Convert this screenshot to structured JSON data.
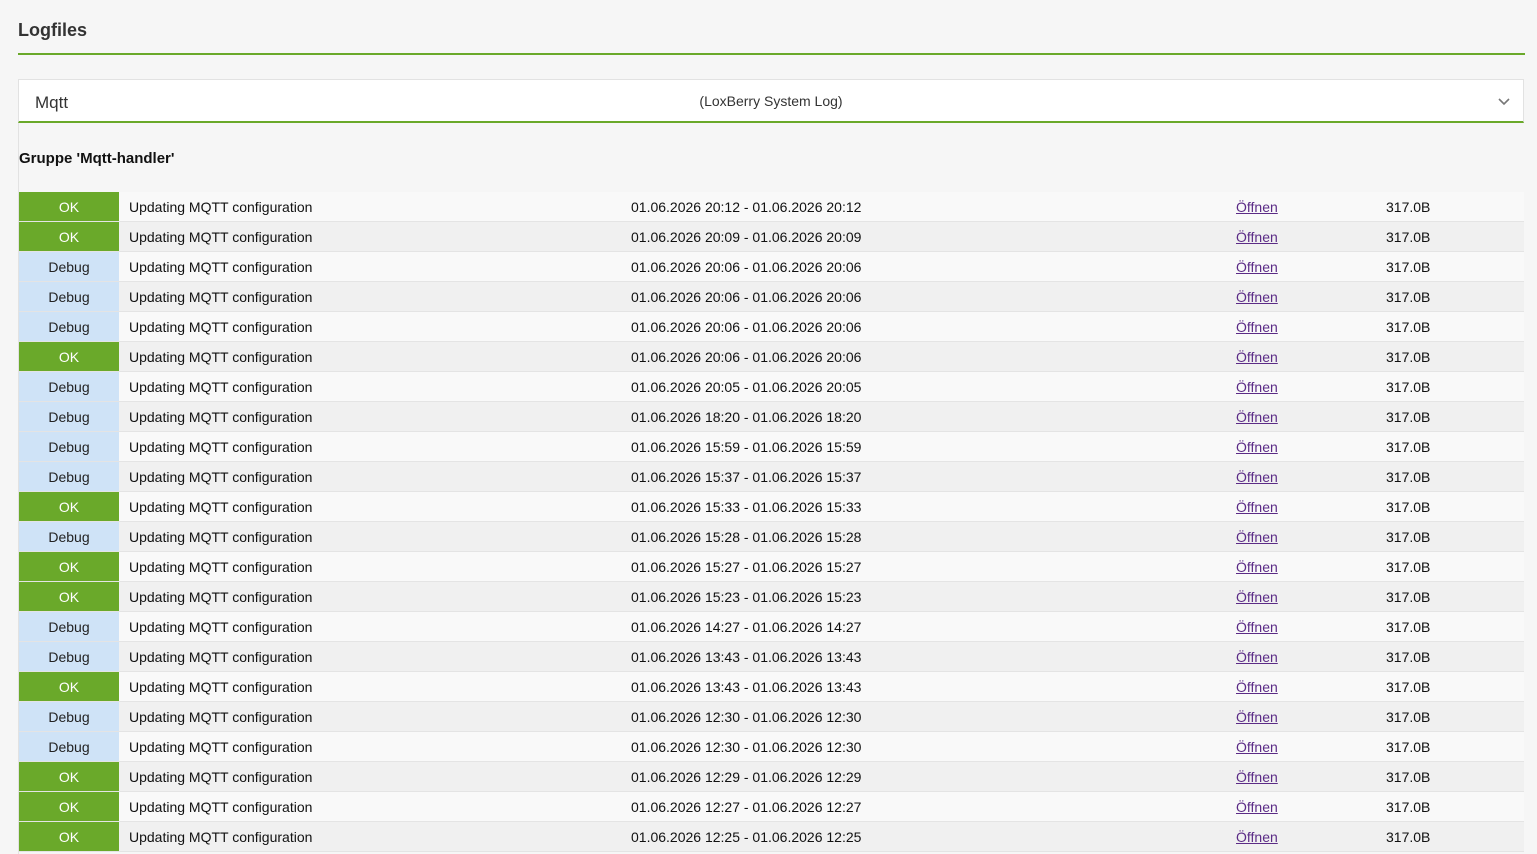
{
  "page": {
    "title": "Logfiles"
  },
  "plugin": {
    "name": "Mqtt",
    "subtitle": "(LoxBerry System Log)"
  },
  "group": {
    "title": "Gruppe 'Mqtt-handler'"
  },
  "colors": {
    "accent": "#6aa92a",
    "ok": "#6aa92a",
    "debug": "#cfe3f7",
    "link": "#5b2b86"
  },
  "icons": {
    "expand": "chevron-down-icon"
  },
  "logs": [
    {
      "level": "OK",
      "desc": "Updating MQTT configuration",
      "time": "01.06.2026 20:12 - 01.06.2026 20:12",
      "open": "Öffnen",
      "size": "317.0B"
    },
    {
      "level": "OK",
      "desc": "Updating MQTT configuration",
      "time": "01.06.2026 20:09 - 01.06.2026 20:09",
      "open": "Öffnen",
      "size": "317.0B"
    },
    {
      "level": "Debug",
      "desc": "Updating MQTT configuration",
      "time": "01.06.2026 20:06 - 01.06.2026 20:06",
      "open": "Öffnen",
      "size": "317.0B"
    },
    {
      "level": "Debug",
      "desc": "Updating MQTT configuration",
      "time": "01.06.2026 20:06 - 01.06.2026 20:06",
      "open": "Öffnen",
      "size": "317.0B"
    },
    {
      "level": "Debug",
      "desc": "Updating MQTT configuration",
      "time": "01.06.2026 20:06 - 01.06.2026 20:06",
      "open": "Öffnen",
      "size": "317.0B"
    },
    {
      "level": "OK",
      "desc": "Updating MQTT configuration",
      "time": "01.06.2026 20:06 - 01.06.2026 20:06",
      "open": "Öffnen",
      "size": "317.0B"
    },
    {
      "level": "Debug",
      "desc": "Updating MQTT configuration",
      "time": "01.06.2026 20:05 - 01.06.2026 20:05",
      "open": "Öffnen",
      "size": "317.0B"
    },
    {
      "level": "Debug",
      "desc": "Updating MQTT configuration",
      "time": "01.06.2026 18:20 - 01.06.2026 18:20",
      "open": "Öffnen",
      "size": "317.0B"
    },
    {
      "level": "Debug",
      "desc": "Updating MQTT configuration",
      "time": "01.06.2026 15:59 - 01.06.2026 15:59",
      "open": "Öffnen",
      "size": "317.0B"
    },
    {
      "level": "Debug",
      "desc": "Updating MQTT configuration",
      "time": "01.06.2026 15:37 - 01.06.2026 15:37",
      "open": "Öffnen",
      "size": "317.0B"
    },
    {
      "level": "OK",
      "desc": "Updating MQTT configuration",
      "time": "01.06.2026 15:33 - 01.06.2026 15:33",
      "open": "Öffnen",
      "size": "317.0B"
    },
    {
      "level": "Debug",
      "desc": "Updating MQTT configuration",
      "time": "01.06.2026 15:28 - 01.06.2026 15:28",
      "open": "Öffnen",
      "size": "317.0B"
    },
    {
      "level": "OK",
      "desc": "Updating MQTT configuration",
      "time": "01.06.2026 15:27 - 01.06.2026 15:27",
      "open": "Öffnen",
      "size": "317.0B"
    },
    {
      "level": "OK",
      "desc": "Updating MQTT configuration",
      "time": "01.06.2026 15:23 - 01.06.2026 15:23",
      "open": "Öffnen",
      "size": "317.0B"
    },
    {
      "level": "Debug",
      "desc": "Updating MQTT configuration",
      "time": "01.06.2026 14:27 - 01.06.2026 14:27",
      "open": "Öffnen",
      "size": "317.0B"
    },
    {
      "level": "Debug",
      "desc": "Updating MQTT configuration",
      "time": "01.06.2026 13:43 - 01.06.2026 13:43",
      "open": "Öffnen",
      "size": "317.0B"
    },
    {
      "level": "OK",
      "desc": "Updating MQTT configuration",
      "time": "01.06.2026 13:43 - 01.06.2026 13:43",
      "open": "Öffnen",
      "size": "317.0B"
    },
    {
      "level": "Debug",
      "desc": "Updating MQTT configuration",
      "time": "01.06.2026 12:30 - 01.06.2026 12:30",
      "open": "Öffnen",
      "size": "317.0B"
    },
    {
      "level": "Debug",
      "desc": "Updating MQTT configuration",
      "time": "01.06.2026 12:30 - 01.06.2026 12:30",
      "open": "Öffnen",
      "size": "317.0B"
    },
    {
      "level": "OK",
      "desc": "Updating MQTT configuration",
      "time": "01.06.2026 12:29 - 01.06.2026 12:29",
      "open": "Öffnen",
      "size": "317.0B"
    },
    {
      "level": "OK",
      "desc": "Updating MQTT configuration",
      "time": "01.06.2026 12:27 - 01.06.2026 12:27",
      "open": "Öffnen",
      "size": "317.0B"
    },
    {
      "level": "OK",
      "desc": "Updating MQTT configuration",
      "time": "01.06.2026 12:25 - 01.06.2026 12:25",
      "open": "Öffnen",
      "size": "317.0B"
    }
  ]
}
